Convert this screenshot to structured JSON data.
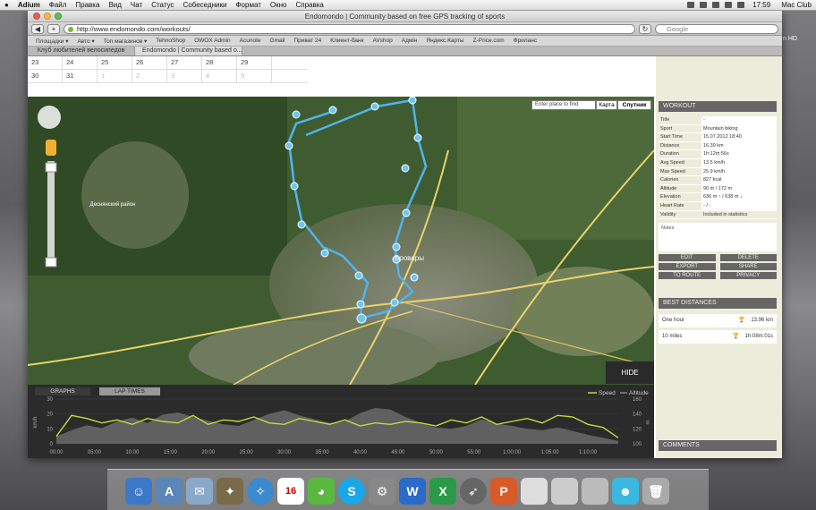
{
  "menubar": {
    "apple": "",
    "items": [
      "Adium",
      "Файл",
      "Правка",
      "Вид",
      "Чат",
      "Статус",
      "Собеседники",
      "Формат",
      "Окно",
      "Справка"
    ],
    "time": "17:59",
    "user": "Mac Club"
  },
  "desktop": {
    "volume_label": "n HD"
  },
  "browser": {
    "title": "Endomondo | Community based on free GPS tracking of sports",
    "url": "http://www.endomondo.com/workouts/",
    "search_placeholder": "Google",
    "bookmarks": [
      "Площадки ▾",
      "Авто ▾",
      "Топ магазинов ▾",
      "TehnoShop",
      "OWOX Admin",
      "Acunote",
      "Gmail",
      "Приват 24",
      "Клиент-банк",
      "AVshop",
      "Адмін",
      "Яндекс.Карты",
      "Z-Price.com",
      "Фриланс"
    ],
    "tabs": [
      {
        "label": "Клуб любителей велосипедов"
      },
      {
        "label": "Endomondo | Community based o..."
      }
    ]
  },
  "calendar": {
    "rows": [
      [
        {
          "d": "23",
          "o": false
        },
        {
          "d": "24",
          "o": false
        },
        {
          "d": "25",
          "o": false
        },
        {
          "d": "26",
          "o": false
        },
        {
          "d": "27",
          "o": false
        },
        {
          "d": "28",
          "o": false
        },
        {
          "d": "29",
          "o": false
        }
      ],
      [
        {
          "d": "30",
          "o": false
        },
        {
          "d": "31",
          "o": false
        },
        {
          "d": "1",
          "o": true
        },
        {
          "d": "2",
          "o": true
        },
        {
          "d": "3",
          "o": true
        },
        {
          "d": "4",
          "o": true
        },
        {
          "d": "5",
          "o": true
        }
      ]
    ]
  },
  "map": {
    "search_placeholder": "Enter place to find",
    "type_map": "Карта",
    "type_satellite": "Спутник",
    "hide": "HIDE",
    "city": "Бровары",
    "district": "Деснянский район"
  },
  "chart_data": {
    "type": "area",
    "tabs": [
      "GRAPHS",
      "LAP TIMES"
    ],
    "legend": [
      "Speed",
      "Altitude"
    ],
    "ylabel_left": "km/h",
    "ylabel_right": "m",
    "yticks_left": [
      "0",
      "10",
      "20",
      "30"
    ],
    "yticks_right": [
      "100",
      "120",
      "140",
      "160"
    ],
    "xticks": [
      "00:00",
      "05:00",
      "10:00",
      "15:00",
      "20:00",
      "25:00",
      "30:00",
      "35:00",
      "40:00",
      "45:00",
      "50:00",
      "55:00",
      "1:00:00",
      "1:05:00",
      "1:10:00"
    ],
    "speed_ylim": [
      0,
      30
    ],
    "altitude_ylim": [
      100,
      160
    ],
    "x_minutes": [
      0,
      2,
      4,
      6,
      8,
      10,
      12,
      14,
      16,
      18,
      20,
      22,
      24,
      26,
      28,
      30,
      32,
      34,
      36,
      38,
      40,
      42,
      44,
      46,
      48,
      50,
      52,
      54,
      56,
      58,
      60,
      62,
      64,
      66,
      68,
      70,
      72,
      74
    ],
    "speed": [
      5,
      19,
      17,
      14,
      16,
      13,
      17,
      15,
      14,
      19,
      13,
      16,
      15,
      18,
      14,
      13,
      17,
      15,
      13,
      16,
      12,
      14,
      13,
      15,
      14,
      12,
      16,
      14,
      18,
      13,
      15,
      17,
      14,
      19,
      18,
      13,
      11,
      4
    ],
    "altitude": [
      110,
      118,
      125,
      121,
      130,
      135,
      128,
      139,
      142,
      136,
      131,
      126,
      124,
      132,
      140,
      145,
      138,
      133,
      128,
      130,
      141,
      148,
      146,
      136,
      128,
      122,
      120,
      124,
      133,
      127,
      124,
      120,
      118,
      122,
      117,
      112,
      108,
      104
    ]
  },
  "workout": {
    "header": "WORKOUT",
    "rows": [
      {
        "k": "Title",
        "v": "-"
      },
      {
        "k": "Sport",
        "v": "Mountain biking"
      },
      {
        "k": "Start Time",
        "v": "15.07.2012 18:40"
      },
      {
        "k": "Distance",
        "v": "16.39 km"
      },
      {
        "k": "Duration",
        "v": "1h:12m:56s"
      },
      {
        "k": "Avg Speed",
        "v": "13.5 km/h"
      },
      {
        "k": "Max Speed",
        "v": "25.9 km/h"
      },
      {
        "k": "Calories",
        "v": "827 kcal"
      },
      {
        "k": "Altitude",
        "v": "90 m / 172 m"
      },
      {
        "k": "Elevation",
        "v": "636 m ↑ / 638 m ↓"
      },
      {
        "k": "Heart Rate",
        "v": "- / -"
      },
      {
        "k": "Validity",
        "v": "Included in statistics"
      }
    ],
    "notes_label": "Notes",
    "actions": [
      "EDIT",
      "DELETE",
      "EXPORT",
      "SHARE",
      "TO ROUTE",
      "PRIVACY"
    ]
  },
  "best": {
    "header": "BEST DISTANCES",
    "rows": [
      {
        "k": "One hour",
        "v": "13.96 km"
      },
      {
        "k": "10 miles",
        "v": "1h:08m:01s"
      }
    ]
  },
  "comments": {
    "header": "COMMENTS"
  },
  "dock": {
    "icons": [
      "finder",
      "app-store",
      "mail",
      "photo",
      "safari",
      "calendar",
      "game",
      "skype",
      "settings",
      "word",
      "excel",
      "rocket",
      "powerpoint",
      "window1",
      "window2",
      "window3",
      "messenger",
      "trash"
    ],
    "calendar_day": "16"
  }
}
